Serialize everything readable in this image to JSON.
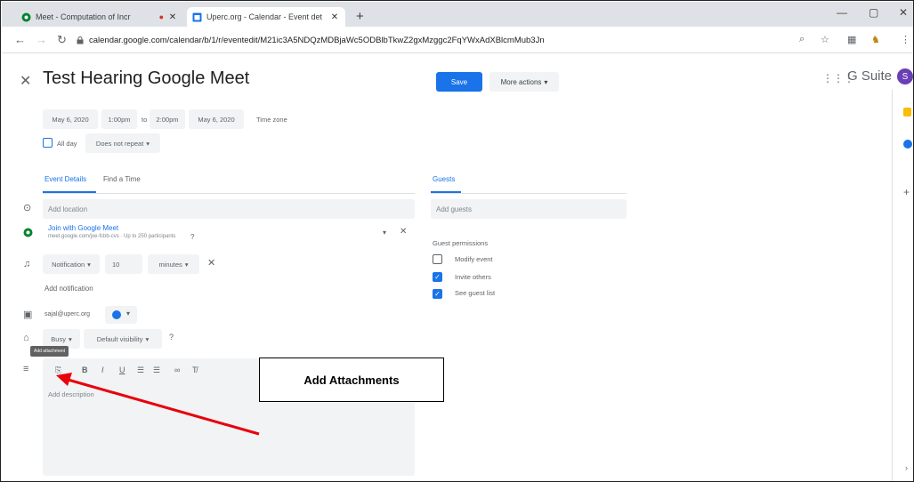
{
  "browser": {
    "tabs": [
      {
        "title": "Meet - Computation of Incr"
      },
      {
        "title": "Uperc.org - Calendar - Event det"
      }
    ],
    "new_tab": "+",
    "url": "calendar.google.com/calendar/b/1/r/eventedit/M21ic3A5NDQzMDBjaWc5ODBlbTkwZ2gxMzggc2FqYWxAdXBlcmMub3Jn"
  },
  "event": {
    "title": "Test Hearing Google Meet",
    "save_label": "Save",
    "more_actions_label": "More actions",
    "start_date": "May 6, 2020",
    "start_time": "1:00pm",
    "to_label": "to",
    "end_time": "2:00pm",
    "end_date": "May 6, 2020",
    "time_zone_label": "Time zone",
    "all_day_label": "All day",
    "repeat_label": "Does not repeat"
  },
  "app": {
    "brand": "G Suite",
    "avatar_letter": "S"
  },
  "tabs": {
    "event_details": "Event Details",
    "find_a_time": "Find a Time",
    "guests": "Guests"
  },
  "details": {
    "location_placeholder": "Add location",
    "meet_link_label": "Join with Google Meet",
    "meet_link_sub": "meet.google.com/jxe-fcbb-cvs · Up to 250 participants",
    "notification_type": "Notification",
    "notification_value": "10",
    "notification_unit": "minutes",
    "add_notification": "Add notification",
    "calendar_owner": "sajal@uperc.org",
    "calendar_color": "#1a73e8",
    "busy_label": "Busy",
    "visibility_label": "Default visibility",
    "attachment_tooltip": "Add attachment",
    "description_placeholder": "Add description"
  },
  "guests": {
    "add_placeholder": "Add guests",
    "permissions_title": "Guest permissions",
    "permissions": [
      {
        "label": "Modify event",
        "checked": false
      },
      {
        "label": "Invite others",
        "checked": true
      },
      {
        "label": "See guest list",
        "checked": true
      }
    ]
  },
  "annotation": {
    "label": "Add Attachments",
    "color": "#e8000b"
  }
}
